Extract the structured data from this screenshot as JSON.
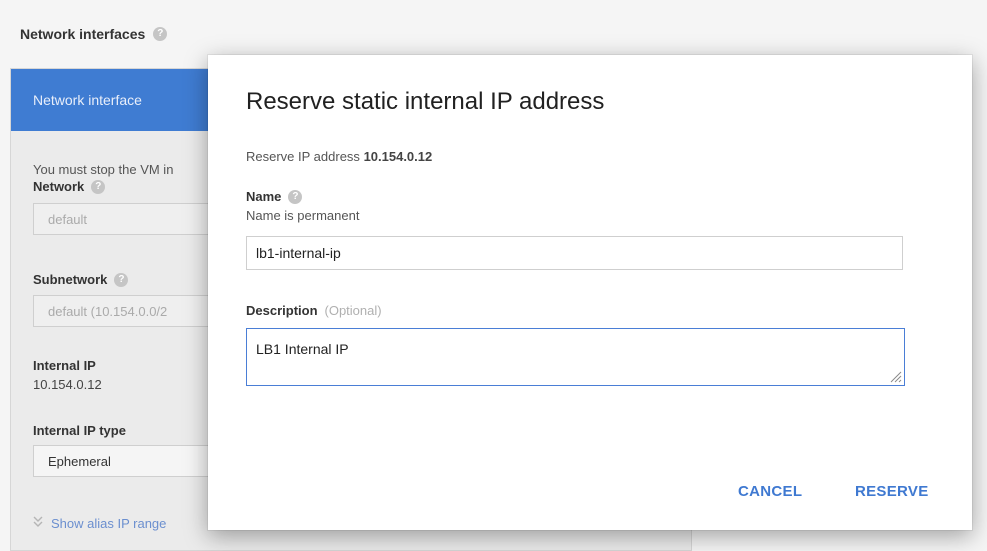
{
  "background": {
    "section_title": "Network interfaces",
    "panel_header": "Network interface",
    "stop_vm_notice": "You must stop the VM in",
    "network_label": "Network",
    "network_value": "default",
    "subnetwork_label": "Subnetwork",
    "subnetwork_value": "default (10.154.0.0/2",
    "internal_ip_label": "Internal IP",
    "internal_ip_value": "10.154.0.12",
    "internal_ip_type_label": "Internal IP type",
    "internal_ip_type_value": "Ephemeral",
    "show_alias_link": "Show alias IP range"
  },
  "dialog": {
    "title": "Reserve static internal IP address",
    "reserve_prefix": "Reserve IP address",
    "reserve_ip": "10.154.0.12",
    "name_label": "Name",
    "name_hint": "Name is permanent",
    "name_value": "lb1-internal-ip",
    "description_label": "Description",
    "description_optional": "(Optional)",
    "description_value": "LB1 Internal IP",
    "cancel_label": "CANCEL",
    "reserve_label": "RESERVE"
  },
  "icons": {
    "help": "help-circle-icon",
    "expand": "double-chevron-down-icon",
    "resize": "resize-grip-icon"
  },
  "colors": {
    "accent": "#3f79d1",
    "panel_header": "#3f7cd2",
    "focus_border": "#4a7ed6"
  }
}
